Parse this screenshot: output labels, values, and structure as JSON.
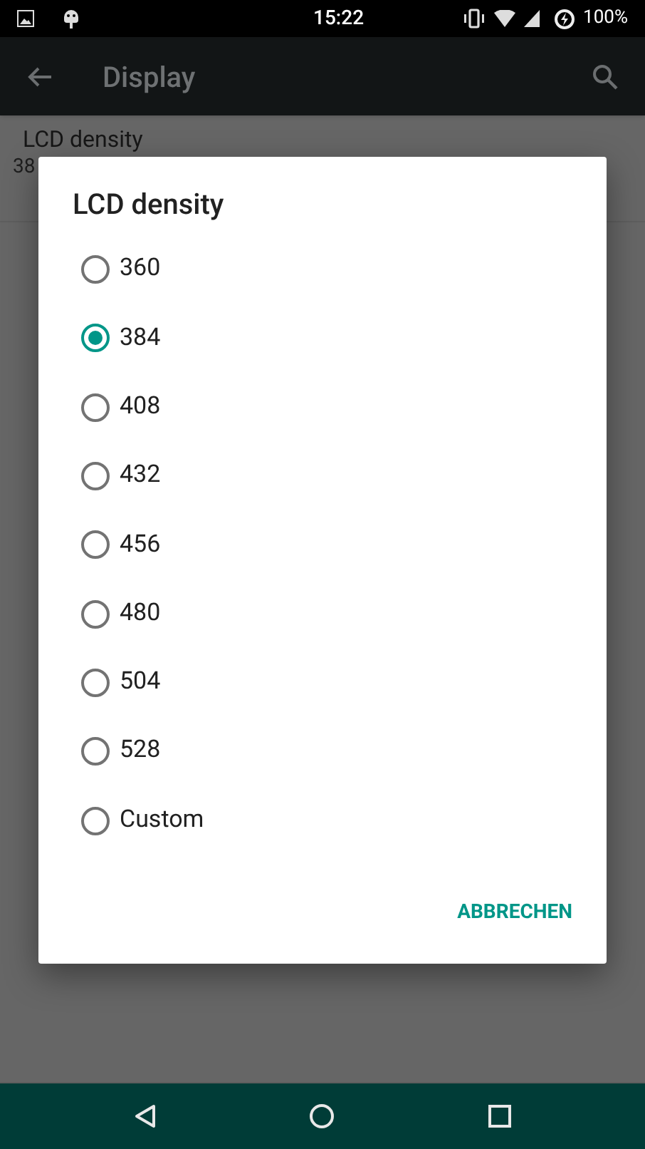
{
  "status_bar": {
    "time": "15:22",
    "battery": "100%"
  },
  "app_bar": {
    "title": "Display"
  },
  "background_setting": {
    "title": "LCD density",
    "summary": "38"
  },
  "dialog": {
    "title": "LCD density",
    "options": [
      {
        "label": "360",
        "selected": false
      },
      {
        "label": "384",
        "selected": true
      },
      {
        "label": "408",
        "selected": false
      },
      {
        "label": "432",
        "selected": false
      },
      {
        "label": "456",
        "selected": false
      },
      {
        "label": "480",
        "selected": false
      },
      {
        "label": "504",
        "selected": false
      },
      {
        "label": "528",
        "selected": false
      },
      {
        "label": "Custom",
        "selected": false
      }
    ],
    "button": "ABBRECHEN"
  }
}
